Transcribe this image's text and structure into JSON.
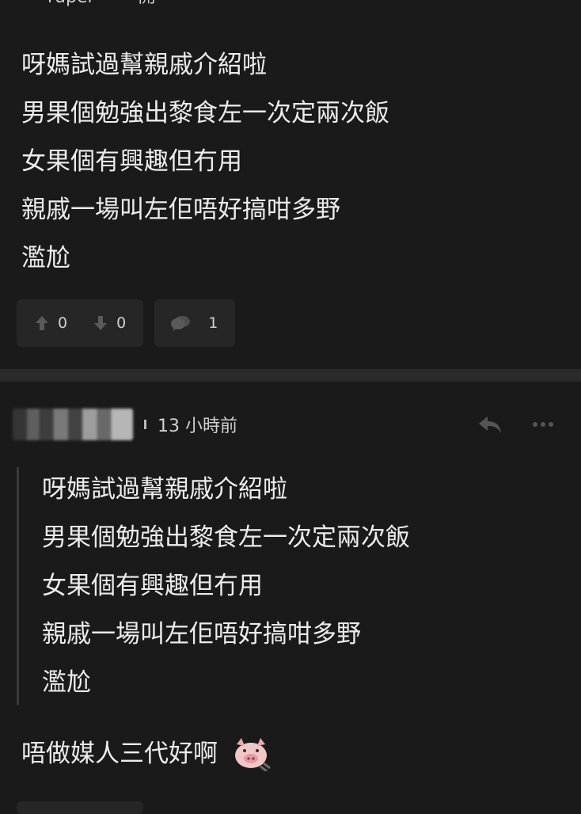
{
  "top_fragment": {
    "name_text": "ruper",
    "mark_text": "- 開"
  },
  "post": {
    "lines": [
      "呀媽試過幫親戚介紹啦",
      "男果個勉強出黎食左一次定兩次飯",
      "女果個有興趣但冇用",
      "親戚一場叫左佢唔好搞咁多野",
      "濫尬"
    ],
    "upvotes": "0",
    "downvotes": "0",
    "comments": "1"
  },
  "reply_comment": {
    "time": "13 小時前",
    "quote_lines": [
      "呀媽試過幫親戚介紹啦",
      "男果個勉強出黎食左一次定兩次飯",
      "女果個有興趣但冇用",
      "親戚一場叫左佢唔好搞咁多野",
      "濫尬"
    ],
    "text": "唔做媒人三代好啊",
    "emoji": "pig-emoji"
  },
  "colors": {
    "background": "#1a1a1a",
    "pill": "#262626",
    "divider": "#2a2a2a",
    "text": "#ececec",
    "muted": "#666666"
  }
}
